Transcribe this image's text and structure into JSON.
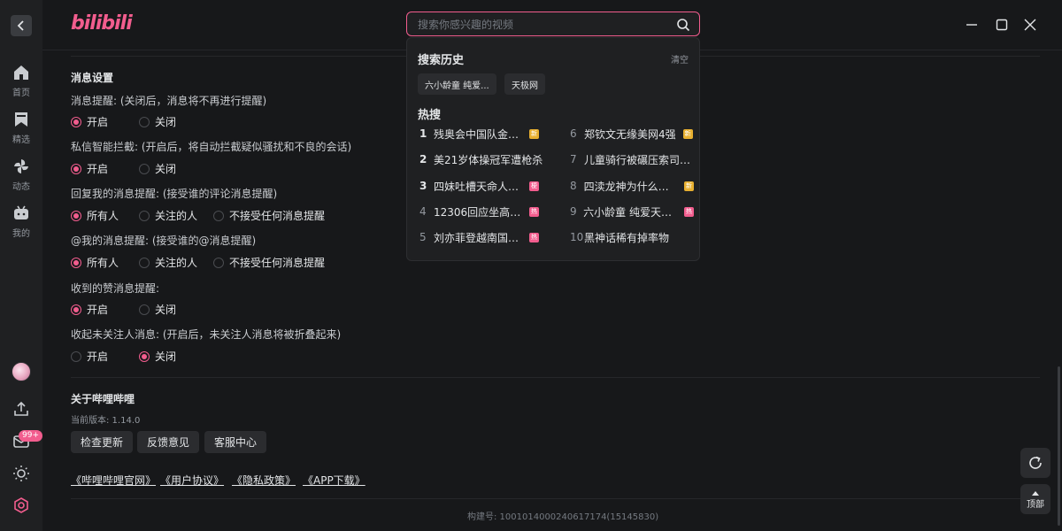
{
  "app": {
    "logo_text": "bilibili"
  },
  "sidebar": {
    "items": [
      {
        "label": "首页",
        "icon": "home-icon"
      },
      {
        "label": "精选",
        "icon": "bookmark-icon"
      },
      {
        "label": "动态",
        "icon": "pinwheel-icon"
      },
      {
        "label": "我的",
        "icon": "tv-icon"
      }
    ],
    "message_badge": "99+"
  },
  "search": {
    "placeholder": "搜索你感兴趣的视频",
    "dropdown": {
      "history_title": "搜索历史",
      "clear_label": "清空",
      "history": [
        "六小龄童 纯爱...",
        "天极网"
      ],
      "hot_title": "热搜",
      "hot_items": [
        {
          "rank": "1",
          "text": "残奥会中国队金牌榜...",
          "tag": "新",
          "tag_type": "new"
        },
        {
          "rank": "2",
          "text": "美21岁体操冠军遭枪杀",
          "tag": "",
          "tag_type": ""
        },
        {
          "rank": "3",
          "text": "四妹吐槽天命人不...",
          "tag": "梗",
          "tag_type": "geng"
        },
        {
          "rank": "4",
          "text": "12306回应坐高铁...",
          "tag": "热",
          "tag_type": "hot2"
        },
        {
          "rank": "5",
          "text": "刘亦菲登越南国家...",
          "tag": "热",
          "tag_type": "hot2"
        },
        {
          "rank": "6",
          "text": "郑钦文无缘美网4强",
          "tag": "新",
          "tag_type": "new"
        },
        {
          "rank": "7",
          "text": "儿童骑行被碾压索司机...",
          "tag": "",
          "tag_type": ""
        },
        {
          "rank": "8",
          "text": "四渎龙神为什么必死",
          "tag": "新",
          "tag_type": "new"
        },
        {
          "rank": "9",
          "text": "六小龄童 纯爱天花板",
          "tag": "热",
          "tag_type": "hot2"
        },
        {
          "rank": "10",
          "text": "黑神话稀有掉率物",
          "tag": "",
          "tag_type": ""
        }
      ]
    }
  },
  "settings": {
    "message_section_title": "消息设置",
    "questions": [
      {
        "label": "消息提醒: (关闭后，消息将不再进行提醒)",
        "options": [
          "开启",
          "关闭"
        ],
        "selected": 0
      },
      {
        "label": "私信智能拦截: (开启后，将自动拦截疑似骚扰和不良的会话)",
        "options": [
          "开启",
          "关闭"
        ],
        "selected": 0
      },
      {
        "label": "回复我的消息提醒: (接受谁的评论消息提醒)",
        "options": [
          "所有人",
          "关注的人",
          "不接受任何消息提醒"
        ],
        "selected": 0
      },
      {
        "label": "@我的消息提醒: (接受谁的@消息提醒)",
        "options": [
          "所有人",
          "关注的人",
          "不接受任何消息提醒"
        ],
        "selected": 0
      },
      {
        "label": "收到的赞消息提醒:",
        "options": [
          "开启",
          "关闭"
        ],
        "selected": 0
      },
      {
        "label": "收起未关注人消息: (开启后，未关注人消息将被折叠起来)",
        "options": [
          "开启",
          "关闭"
        ],
        "selected": 1
      }
    ],
    "about_title": "关于哔哩哔哩",
    "version_text": "当前版本: 1.14.0",
    "buttons": [
      "检查更新",
      "反馈意见",
      "客服中心"
    ],
    "links": [
      "《哔哩哔哩官网》",
      "《用户协议》",
      "《隐私政策》",
      "《APP下载》"
    ],
    "build_text": "构建号: 1001014000240617174(15145830)"
  },
  "float": {
    "top_label": "顶部"
  },
  "colors": {
    "accent": "#f25d8e",
    "background": "#17181a",
    "sidebar": "#1f2022"
  }
}
